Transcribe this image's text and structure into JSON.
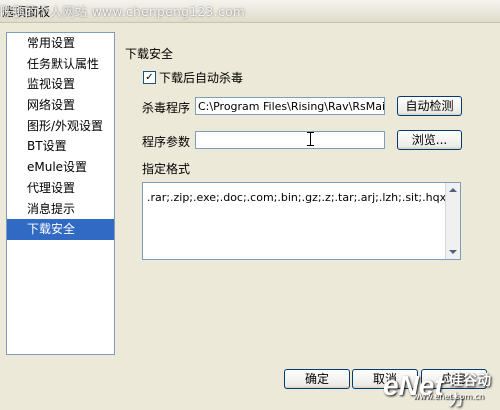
{
  "window": {
    "title": "选项面板",
    "watermark": "陈鹏的个人网站 www.chenpeng123.com"
  },
  "nav": {
    "items": [
      {
        "label": "常用设置"
      },
      {
        "label": "任务默认属性"
      },
      {
        "label": "监视设置"
      },
      {
        "label": "网络设置"
      },
      {
        "label": "图形/外观设置"
      },
      {
        "label": "BT设置"
      },
      {
        "label": "eMule设置"
      },
      {
        "label": "代理设置"
      },
      {
        "label": "消息提示"
      },
      {
        "label": "下载安全",
        "selected": true
      }
    ]
  },
  "panel": {
    "section_title": "下载安全",
    "auto_kill_label": "下载后自动杀毒",
    "auto_kill_checked": true,
    "antivirus_label": "杀毒程序",
    "antivirus_path": "C:\\Program Files\\Rising\\Rav\\RsMain.exe",
    "auto_detect_button": "自动检测",
    "params_label": "程序参数",
    "params_value": "",
    "browse_button": "浏览...",
    "formats_label": "指定格式",
    "formats_value": ".rar;.zip;.exe;.doc;.com;.bin;.gz;.z;.tar;.arj;.lzh;.sit;.hqx;.tgz;."
  },
  "buttons": {
    "ok": "确定",
    "cancel": "取消",
    "apply": "应用"
  },
  "logo": {
    "brand": "eNet",
    "brand_cn": "硅谷动力",
    "url": "www.enet.com.cn"
  }
}
